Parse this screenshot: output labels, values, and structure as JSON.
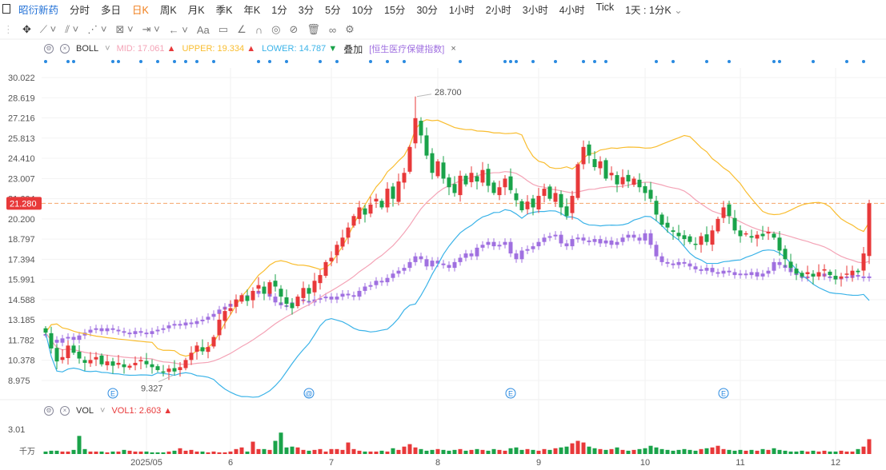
{
  "topbar": {
    "stock_name": "昭衍新药",
    "periods": [
      "分时",
      "多日",
      "日K",
      "周K",
      "月K",
      "季K",
      "年K",
      "1分",
      "3分",
      "5分",
      "10分",
      "15分",
      "30分",
      "1小时",
      "2小时",
      "3小时",
      "4小时",
      "Tick"
    ],
    "active_period": "日K",
    "interval_select": "1天 : 1分K"
  },
  "toolbar": {
    "icons": [
      "move-icon",
      "line-icon",
      "channel-icon",
      "wave-icon",
      "fib-icon",
      "measure-icon",
      "arrow-icon",
      "text-icon",
      "note-icon",
      "ruler-icon",
      "magnet-icon",
      "eye-icon",
      "hide-icon",
      "trash-icon",
      "link-icon",
      "settings-icon"
    ],
    "text_tool": "Aa"
  },
  "boll": {
    "name": "BOLL",
    "mid_label": "MID:",
    "mid": "17.061",
    "upper_label": "UPPER:",
    "upper": "19.334",
    "lower_label": "LOWER:",
    "lower": "14.787",
    "overlay_label": "叠加",
    "overlay_name": "[恒生医疗保健指数]",
    "close": "×"
  },
  "vol": {
    "name": "VOL",
    "vol1_label": "VOL1:",
    "vol1": "2.603",
    "unit": "千万",
    "axis_max": "3.01"
  },
  "colors": {
    "up": "#e8393a",
    "down": "#1aa34a",
    "mid": "#f4a3b6",
    "upper": "#f9bd2f",
    "lower": "#3bb3e8",
    "overlay": "#a070e0",
    "last_price": "#f5a56a"
  },
  "chart_data": {
    "type": "candlestick",
    "y_ticks": [
      "30.022",
      "28.619",
      "27.216",
      "25.813",
      "24.410",
      "23.007",
      "21.604",
      "20.200",
      "18.797",
      "17.394",
      "15.991",
      "14.588",
      "13.185",
      "11.782",
      "10.378",
      "8.975"
    ],
    "ylim": [
      8.975,
      30.022
    ],
    "x_labels": [
      "2025/05",
      "6",
      "7",
      "8",
      "9",
      "10",
      "11",
      "12"
    ],
    "x_label_index": [
      18,
      33,
      51,
      70,
      88,
      107,
      124,
      141
    ],
    "last_price": "21.280",
    "high_label": "28.700",
    "high_value": 28.7,
    "low_label": "9.327",
    "low_value": 9.327,
    "event_markers": [
      {
        "index": 12,
        "glyph": "E"
      },
      {
        "index": 47,
        "glyph": "@"
      },
      {
        "index": 83,
        "glyph": "E"
      },
      {
        "index": 121,
        "glyph": "E"
      }
    ],
    "close": [
      12.3,
      11.2,
      10.3,
      10.6,
      11.4,
      10.9,
      10.5,
      10.2,
      10.4,
      10.6,
      10.1,
      10.3,
      10.0,
      10.2,
      9.9,
      10.0,
      10.2,
      10.4,
      10.1,
      9.9,
      9.7,
      9.6,
      9.8,
      9.6,
      9.9,
      10.4,
      10.9,
      11.4,
      11.0,
      11.3,
      12.0,
      13.2,
      13.8,
      14.0,
      14.6,
      14.9,
      14.5,
      15.2,
      15.6,
      15.0,
      15.8,
      15.5,
      14.8,
      14.3,
      14.0,
      14.8,
      15.4,
      15.0,
      15.9,
      16.3,
      17.2,
      17.5,
      18.4,
      18.9,
      19.6,
      20.4,
      21.0,
      20.5,
      21.2,
      21.6,
      21.0,
      22.3,
      21.6,
      22.8,
      23.4,
      25.2,
      27.2,
      26.0,
      24.6,
      23.4,
      24.2,
      23.0,
      22.4,
      22.0,
      23.2,
      22.6,
      23.4,
      22.8,
      23.6,
      22.5,
      22.0,
      22.4,
      23.0,
      22.2,
      21.5,
      20.8,
      21.4,
      21.0,
      21.8,
      22.3,
      21.6,
      22.0,
      21.0,
      20.4,
      21.8,
      24.0,
      25.2,
      24.6,
      23.8,
      24.2,
      23.0,
      23.4,
      22.6,
      23.1,
      22.8,
      23.0,
      22.4,
      22.0,
      21.6,
      20.5,
      19.8,
      19.6,
      19.3,
      19.0,
      18.8,
      18.6,
      18.4,
      19.0,
      18.6,
      19.4,
      20.2,
      21.0,
      20.4,
      19.4,
      19.0,
      19.2,
      18.9,
      19.1,
      19.0,
      19.3,
      18.9,
      18.0,
      17.4,
      16.8,
      16.4,
      16.2,
      16.5,
      16.2,
      16.5,
      16.7,
      16.3,
      16.0,
      16.2,
      16.4,
      16.6,
      16.5,
      17.8,
      21.28
    ],
    "overlay": [
      12.2,
      11.8,
      11.6,
      11.9,
      12.0,
      11.8,
      12.1,
      12.3,
      12.5,
      12.6,
      12.4,
      12.6,
      12.5,
      12.4,
      12.3,
      12.2,
      12.4,
      12.3,
      12.2,
      12.4,
      12.5,
      12.6,
      12.8,
      12.9,
      12.8,
      13.0,
      12.9,
      13.1,
      13.2,
      13.4,
      13.6,
      13.9,
      14.1,
      14.3,
      14.6,
      14.7,
      14.9,
      15.0,
      15.2,
      15.1,
      14.8,
      14.4,
      14.2,
      14.1,
      14.4,
      14.6,
      14.5,
      14.4,
      14.6,
      14.7,
      14.8,
      14.6,
      14.8,
      15.0,
      14.9,
      14.8,
      15.2,
      15.5,
      15.6,
      15.9,
      15.8,
      16.1,
      16.4,
      16.6,
      16.8,
      17.2,
      17.6,
      17.4,
      16.9,
      17.3,
      17.1,
      17.0,
      16.8,
      17.2,
      17.5,
      17.8,
      17.6,
      18.2,
      18.4,
      18.6,
      18.3,
      18.4,
      18.6,
      17.8,
      17.4,
      18.0,
      18.1,
      18.3,
      18.6,
      18.9,
      19.0,
      19.1,
      18.5,
      18.3,
      18.8,
      18.9,
      18.7,
      18.6,
      18.8,
      18.5,
      18.7,
      18.4,
      18.6,
      18.9,
      19.1,
      18.9,
      18.7,
      19.2,
      18.4,
      17.6,
      17.2,
      17.1,
      17.0,
      17.2,
      17.1,
      16.9,
      16.7,
      16.6,
      16.8,
      16.5,
      16.4,
      16.6,
      16.5,
      16.3,
      16.4,
      16.3,
      16.5,
      16.2,
      16.4,
      16.6,
      17.2,
      17.0,
      16.8,
      16.5,
      16.3,
      16.1,
      16.2,
      16.3,
      16.4,
      16.2,
      16.1,
      16.0,
      16.2,
      16.1,
      16.3,
      16.2,
      16.1,
      16.2
    ],
    "volume": [
      0.3,
      0.4,
      0.4,
      0.3,
      0.3,
      0.5,
      2.2,
      0.6,
      0.3,
      0.3,
      0.3,
      0.2,
      0.3,
      0.3,
      0.5,
      0.4,
      0.3,
      0.3,
      0.3,
      0.2,
      0.2,
      0.2,
      0.3,
      0.4,
      0.7,
      0.4,
      0.5,
      0.3,
      0.3,
      0.2,
      0.3,
      0.2,
      0.2,
      0.3,
      0.6,
      0.8,
      0.3,
      1.5,
      0.6,
      0.6,
      0.5,
      1.6,
      2.6,
      0.8,
      0.9,
      0.8,
      0.5,
      0.4,
      0.5,
      0.6,
      0.3,
      0.6,
      0.6,
      0.5,
      1.4,
      0.6,
      0.4,
      0.3,
      0.3,
      0.3,
      0.4,
      0.3,
      0.7,
      0.5,
      0.9,
      1.2,
      0.8,
      0.6,
      0.4,
      0.5,
      0.6,
      0.5,
      0.4,
      0.5,
      0.6,
      0.4,
      0.5,
      0.6,
      0.5,
      0.4,
      0.6,
      0.5,
      0.4,
      0.7,
      0.8,
      0.5,
      0.6,
      0.5,
      0.4,
      0.6,
      0.5,
      0.7,
      0.8,
      0.9,
      1.3,
      1.6,
      1.4,
      0.9,
      0.7,
      0.6,
      0.5,
      0.6,
      0.8,
      0.5,
      0.4,
      0.5,
      0.6,
      0.7,
      1.0,
      0.8,
      0.6,
      0.5,
      0.4,
      0.5,
      0.6,
      0.5,
      0.4,
      0.6,
      0.7,
      0.8,
      1.0,
      0.6,
      0.5,
      0.4,
      0.5,
      0.4,
      0.5,
      0.4,
      0.6,
      0.5,
      0.7,
      0.5,
      0.4,
      0.3,
      0.3,
      0.4,
      0.3,
      0.4,
      0.3,
      0.4,
      0.3,
      0.3,
      0.4,
      0.3,
      0.3,
      0.6,
      0.9,
      1.8
    ],
    "vol_ylim": [
      0,
      3.01
    ]
  }
}
